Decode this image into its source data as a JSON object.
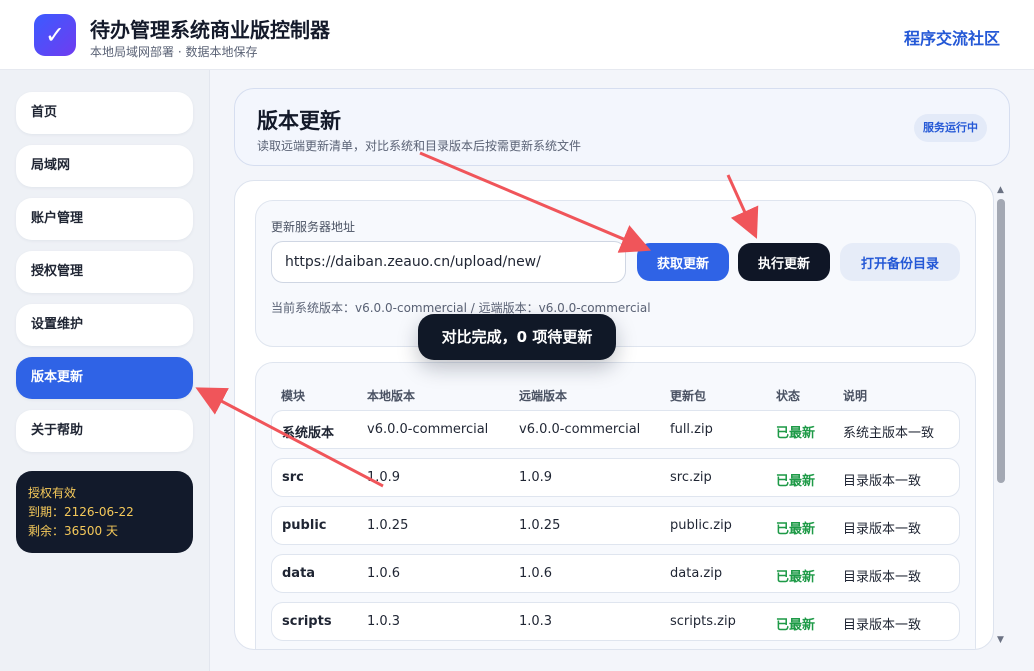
{
  "header": {
    "logo_glyph": "✓",
    "title": "待办管理系统商业版控制器",
    "subtitle": "本地局域网部署 · 数据本地保存",
    "community_link": "程序交流社区"
  },
  "sidebar": {
    "items": [
      {
        "label": "首页",
        "active": false
      },
      {
        "label": "局域网",
        "active": false
      },
      {
        "label": "账户管理",
        "active": false
      },
      {
        "label": "授权管理",
        "active": false
      },
      {
        "label": "设置维护",
        "active": false
      },
      {
        "label": "版本更新",
        "active": true
      },
      {
        "label": "关于帮助",
        "active": false
      }
    ],
    "license": {
      "status": "授权有效",
      "expiry": "到期：2126-06-22",
      "remaining": "剩余：36500 天"
    }
  },
  "page": {
    "title": "版本更新",
    "description": "读取远端更新清单，对比系统和目录版本后按需更新系统文件",
    "status_badge": "服务运行中"
  },
  "server": {
    "label": "更新服务器地址",
    "url": "https://daiban.zeauo.cn/upload/new/",
    "fetch_button": "获取更新",
    "execute_button": "执行更新",
    "backup_button": "打开备份目录",
    "version_line": "当前系统版本：v6.0.0-commercial / 远端版本：v6.0.0-commercial"
  },
  "toast": "对比完成，0 项待更新",
  "table": {
    "headers": [
      "模块",
      "本地版本",
      "远端版本",
      "更新包",
      "状态",
      "说明"
    ],
    "rows": [
      [
        "系统版本",
        "v6.0.0-commercial",
        "v6.0.0-commercial",
        "full.zip",
        "已最新",
        "系统主版本一致"
      ],
      [
        "src",
        "1.0.9",
        "1.0.9",
        "src.zip",
        "已最新",
        "目录版本一致"
      ],
      [
        "public",
        "1.0.25",
        "1.0.25",
        "public.zip",
        "已最新",
        "目录版本一致"
      ],
      [
        "data",
        "1.0.6",
        "1.0.6",
        "data.zip",
        "已最新",
        "目录版本一致"
      ],
      [
        "scripts",
        "1.0.3",
        "1.0.3",
        "scripts.zip",
        "已最新",
        "目录版本一致"
      ]
    ]
  },
  "colors": {
    "accent": "#2f63e6",
    "dark": "#0f1626",
    "success": "#1e9a47",
    "annotation_arrow": "#f0555a"
  }
}
